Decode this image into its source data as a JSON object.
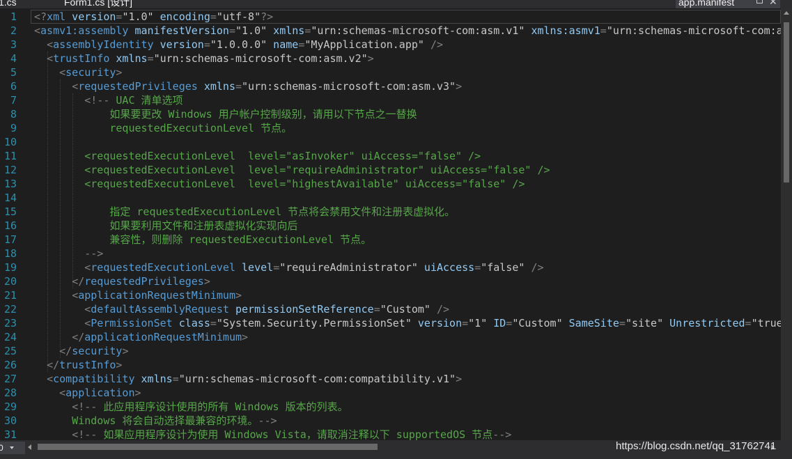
{
  "tabs": {
    "left_file": "1.cs",
    "designer_file": "Form1.cs [设计]",
    "active_file": "app.manifest",
    "close_glyph": "✕",
    "pin_icon": "pin-icon"
  },
  "editor": {
    "line_numbers": [
      "1",
      "2",
      "3",
      "4",
      "5",
      "6",
      "7",
      "8",
      "9",
      "10",
      "11",
      "12",
      "13",
      "14",
      "15",
      "16",
      "17",
      "18",
      "19",
      "20",
      "21",
      "22",
      "23",
      "24",
      "25",
      "26",
      "27",
      "28",
      "29",
      "30",
      "31"
    ],
    "lines": [
      [
        [
          "d",
          "<?"
        ],
        [
          "e",
          "xml"
        ],
        [
          "a",
          " version"
        ],
        [
          "d",
          "="
        ],
        [
          "s",
          "\"1.0\""
        ],
        [
          "a",
          " encoding"
        ],
        [
          "d",
          "="
        ],
        [
          "s",
          "\"utf-8\""
        ],
        [
          "d",
          "?>"
        ]
      ],
      [
        [
          "d",
          "<"
        ],
        [
          "e",
          "asmv1:assembly"
        ],
        [
          "a",
          " manifestVersion"
        ],
        [
          "d",
          "="
        ],
        [
          "s",
          "\"1.0\""
        ],
        [
          "a",
          " xmlns"
        ],
        [
          "d",
          "="
        ],
        [
          "s",
          "\"urn:schemas-microsoft-com:asm.v1\""
        ],
        [
          "a",
          " xmlns:asmv1"
        ],
        [
          "d",
          "="
        ],
        [
          "s",
          "\"urn:schemas-microsoft-com:a"
        ]
      ],
      [
        [
          "v",
          "  "
        ],
        [
          "d",
          "<"
        ],
        [
          "e",
          "assemblyIdentity"
        ],
        [
          "a",
          " version"
        ],
        [
          "d",
          "="
        ],
        [
          "s",
          "\"1.0.0.0\""
        ],
        [
          "a",
          " name"
        ],
        [
          "d",
          "="
        ],
        [
          "s",
          "\"MyApplication.app\""
        ],
        [
          "d",
          " />"
        ]
      ],
      [
        [
          "v",
          "  "
        ],
        [
          "d",
          "<"
        ],
        [
          "e",
          "trustInfo"
        ],
        [
          "a",
          " xmlns"
        ],
        [
          "d",
          "="
        ],
        [
          "s",
          "\"urn:schemas-microsoft-com:asm.v2\""
        ],
        [
          "d",
          ">"
        ]
      ],
      [
        [
          "v",
          "    "
        ],
        [
          "d",
          "<"
        ],
        [
          "e",
          "security"
        ],
        [
          "d",
          ">"
        ]
      ],
      [
        [
          "v",
          "      "
        ],
        [
          "d",
          "<"
        ],
        [
          "e",
          "requestedPrivileges"
        ],
        [
          "a",
          " xmlns"
        ],
        [
          "d",
          "="
        ],
        [
          "s",
          "\"urn:schemas-microsoft-com:asm.v3\""
        ],
        [
          "d",
          ">"
        ]
      ],
      [
        [
          "v",
          "        "
        ],
        [
          "d",
          "<!--"
        ],
        [
          "c",
          " UAC 清单选项"
        ]
      ],
      [
        [
          "c",
          "            如果要更改 Windows 用户帐户控制级别，请用以下节点之一替换"
        ]
      ],
      [
        [
          "c",
          "            requestedExecutionLevel 节点。"
        ]
      ],
      [
        [
          "c",
          ""
        ]
      ],
      [
        [
          "c",
          "        <requestedExecutionLevel  level=\"asInvoker\" uiAccess=\"false\" />"
        ]
      ],
      [
        [
          "c",
          "        <requestedExecutionLevel  level=\"requireAdministrator\" uiAccess=\"false\" />"
        ]
      ],
      [
        [
          "c",
          "        <requestedExecutionLevel  level=\"highestAvailable\" uiAccess=\"false\" />"
        ]
      ],
      [
        [
          "c",
          ""
        ]
      ],
      [
        [
          "c",
          "            指定 requestedExecutionLevel 节点将会禁用文件和注册表虚拟化。"
        ]
      ],
      [
        [
          "c",
          "            如果要利用文件和注册表虚拟化实现向后"
        ]
      ],
      [
        [
          "c",
          "            兼容性，则删除 requestedExecutionLevel 节点。"
        ]
      ],
      [
        [
          "c",
          "        "
        ],
        [
          "d",
          "-->"
        ]
      ],
      [
        [
          "v",
          "        "
        ],
        [
          "d",
          "<"
        ],
        [
          "e",
          "requestedExecutionLevel"
        ],
        [
          "a",
          " level"
        ],
        [
          "d",
          "="
        ],
        [
          "s",
          "\"requireAdministrator\""
        ],
        [
          "a",
          " uiAccess"
        ],
        [
          "d",
          "="
        ],
        [
          "s",
          "\"false\""
        ],
        [
          "d",
          " />"
        ]
      ],
      [
        [
          "v",
          "      "
        ],
        [
          "d",
          "</"
        ],
        [
          "e",
          "requestedPrivileges"
        ],
        [
          "d",
          ">"
        ]
      ],
      [
        [
          "v",
          "      "
        ],
        [
          "d",
          "<"
        ],
        [
          "e",
          "applicationRequestMinimum"
        ],
        [
          "d",
          ">"
        ]
      ],
      [
        [
          "v",
          "        "
        ],
        [
          "d",
          "<"
        ],
        [
          "e",
          "defaultAssemblyRequest"
        ],
        [
          "a",
          " permissionSetReference"
        ],
        [
          "d",
          "="
        ],
        [
          "s",
          "\"Custom\""
        ],
        [
          "d",
          " />"
        ]
      ],
      [
        [
          "v",
          "        "
        ],
        [
          "d",
          "<"
        ],
        [
          "e",
          "PermissionSet"
        ],
        [
          "a",
          " class"
        ],
        [
          "d",
          "="
        ],
        [
          "s",
          "\"System.Security.PermissionSet\""
        ],
        [
          "a",
          " version"
        ],
        [
          "d",
          "="
        ],
        [
          "s",
          "\"1\""
        ],
        [
          "a",
          " ID"
        ],
        [
          "d",
          "="
        ],
        [
          "s",
          "\"Custom\""
        ],
        [
          "a",
          " SameSite"
        ],
        [
          "d",
          "="
        ],
        [
          "s",
          "\"site\""
        ],
        [
          "a",
          " Unrestricted"
        ],
        [
          "d",
          "="
        ],
        [
          "s",
          "\"true"
        ]
      ],
      [
        [
          "v",
          "      "
        ],
        [
          "d",
          "</"
        ],
        [
          "e",
          "applicationRequestMinimum"
        ],
        [
          "d",
          ">"
        ]
      ],
      [
        [
          "v",
          "    "
        ],
        [
          "d",
          "</"
        ],
        [
          "e",
          "security"
        ],
        [
          "d",
          ">"
        ]
      ],
      [
        [
          "v",
          "  "
        ],
        [
          "d",
          "</"
        ],
        [
          "e",
          "trustInfo"
        ],
        [
          "d",
          ">"
        ]
      ],
      [
        [
          "v",
          "  "
        ],
        [
          "d",
          "<"
        ],
        [
          "e",
          "compatibility"
        ],
        [
          "a",
          " xmlns"
        ],
        [
          "d",
          "="
        ],
        [
          "s",
          "\"urn:schemas-microsoft-com:compatibility.v1\""
        ],
        [
          "d",
          ">"
        ]
      ],
      [
        [
          "v",
          "    "
        ],
        [
          "d",
          "<"
        ],
        [
          "e",
          "application"
        ],
        [
          "d",
          ">"
        ]
      ],
      [
        [
          "v",
          "      "
        ],
        [
          "d",
          "<!--"
        ],
        [
          "c",
          " 此应用程序设计使用的所有 Windows 版本的列表。"
        ]
      ],
      [
        [
          "c",
          "      Windows 将会自动选择最兼容的环境。"
        ],
        [
          "d",
          "-->"
        ]
      ],
      [
        [
          "v",
          "      "
        ],
        [
          "d",
          "<!--"
        ],
        [
          "c",
          " 如果应用程序设计为使用 Windows Vista，请取消注释以下 supportedOS 节点"
        ],
        [
          "d",
          "-->"
        ]
      ]
    ]
  },
  "statusbar": {
    "zoom_value": "0",
    "watermark": "https://blog.csdn.net/qq_31762741"
  },
  "colors": {
    "background": "#1e1e1e",
    "line_number": "#2b91af",
    "element": "#569cd6",
    "attribute": "#92caf4",
    "comment": "#57a64a",
    "delimiter": "#808080"
  }
}
